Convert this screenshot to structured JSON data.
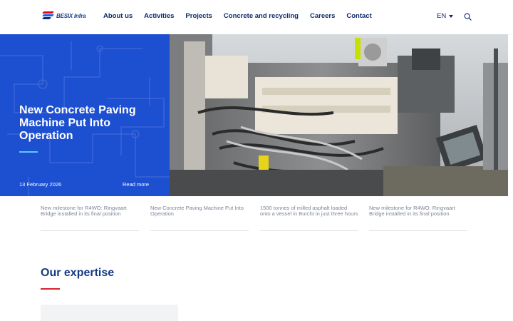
{
  "header": {
    "logo_text": "BESIX Infra",
    "nav": [
      "About us",
      "Activities",
      "Projects",
      "Concrete and recycling",
      "Careers",
      "Contact"
    ],
    "language": "EN"
  },
  "hero": {
    "title": "New Concrete Paving Machine Put Into Operation",
    "date": "13 February 2026",
    "read_more": "Read more",
    "colors": {
      "panel": "#1d4fd1",
      "accent": "#5cc8ff"
    }
  },
  "news": [
    "New milestone for R4WO: Ringvaart Bridge installed in its final position",
    "New Concrete Paving Machine Put Into Operation",
    "1500 tonnes of milled asphalt loaded onto a vessel in Burcht in just three hours",
    "New milestone for R4WO: Ringvaart Bridge installed in its final position"
  ],
  "expertise": {
    "title": "Our expertise"
  },
  "icons": {
    "search": "search-icon",
    "language_caret": "chevron-down-icon"
  }
}
